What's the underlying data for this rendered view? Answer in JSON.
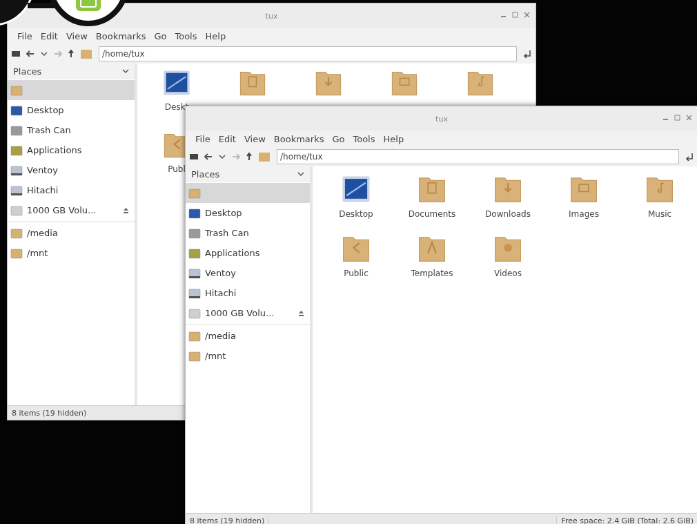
{
  "windows": [
    {
      "title": "tux",
      "menu": [
        "File",
        "Edit",
        "View",
        "Bookmarks",
        "Go",
        "Tools",
        "Help"
      ],
      "path": "/home/tux",
      "sidebar": {
        "header": "Places",
        "sections": [
          [
            {
              "kind": "home",
              "selected": true
            },
            {
              "kind": "desktop",
              "label": "Desktop",
              "selected": false
            },
            {
              "kind": "trash",
              "label": "Trash Can",
              "selected": false
            },
            {
              "kind": "apps",
              "label": "Applications",
              "selected": false
            },
            {
              "kind": "drive",
              "label": "Ventoy",
              "selected": false
            },
            {
              "kind": "drive",
              "label": "Hitachi",
              "selected": false
            },
            {
              "kind": "volume",
              "label": "1000 GB Volu...",
              "selected": false,
              "ejectable": true
            }
          ],
          [
            {
              "kind": "folder",
              "label": "/media",
              "selected": false
            },
            {
              "kind": "folder",
              "label": "/mnt",
              "selected": false
            }
          ]
        ]
      },
      "files": [
        {
          "kind": "desktop",
          "label": "Deskt"
        },
        {
          "kind": "documents"
        },
        {
          "kind": "downloads"
        },
        {
          "kind": "images"
        },
        {
          "kind": "music"
        },
        {
          "kind": "public",
          "label": "Publ"
        }
      ],
      "status": [
        "8 items (19 hidden)"
      ]
    },
    {
      "title": "tux",
      "menu": [
        "File",
        "Edit",
        "View",
        "Bookmarks",
        "Go",
        "Tools",
        "Help"
      ],
      "path": "/home/tux",
      "sidebar": {
        "header": "Places",
        "sections": [
          [
            {
              "kind": "home",
              "selected": true
            },
            {
              "kind": "desktop",
              "label": "Desktop",
              "selected": false
            },
            {
              "kind": "trash",
              "label": "Trash Can",
              "selected": false
            },
            {
              "kind": "apps",
              "label": "Applications",
              "selected": false
            },
            {
              "kind": "drive",
              "label": "Ventoy",
              "selected": false
            },
            {
              "kind": "drive",
              "label": "Hitachi",
              "selected": false
            },
            {
              "kind": "volume",
              "label": "1000 GB Volu...",
              "selected": false,
              "ejectable": true
            }
          ],
          [
            {
              "kind": "folder",
              "label": "/media",
              "selected": false
            },
            {
              "kind": "folder",
              "label": "/mnt",
              "selected": false
            }
          ]
        ]
      },
      "files": [
        {
          "kind": "desktop",
          "label": "Desktop"
        },
        {
          "kind": "documents",
          "label": "Documents"
        },
        {
          "kind": "downloads",
          "label": "Downloads"
        },
        {
          "kind": "images",
          "label": "Images"
        },
        {
          "kind": "music",
          "label": "Music"
        },
        {
          "kind": "public",
          "label": "Public"
        },
        {
          "kind": "templates",
          "label": "Templates"
        },
        {
          "kind": "videos",
          "label": "Videos"
        }
      ],
      "status": [
        "8 items (19 hidden)",
        "Free space: 2.4 GiB (Total: 2.6 GiB)"
      ]
    }
  ]
}
